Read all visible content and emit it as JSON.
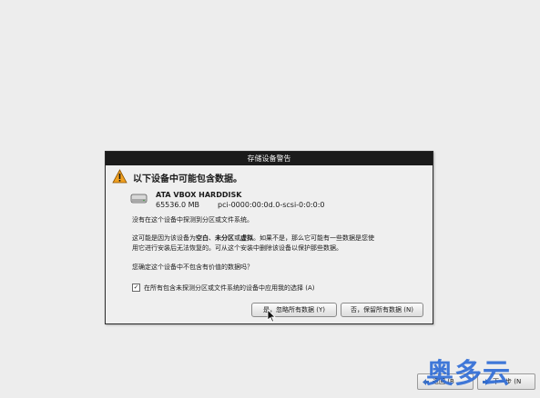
{
  "dialog": {
    "title": "存储设备警告",
    "heading": "以下设备中可能包含数据。",
    "disk": {
      "name": "ATA VBOX HARDDISK",
      "size": "65536.0 MB",
      "path": "pci-0000:00:0d.0-scsi-0:0:0:0"
    },
    "line1": "没有在这个设备中探测到分区或文件系统。",
    "line2_pre": "这可能是因为该设备为",
    "line2_blank": "空白",
    "line2_sep": "、",
    "line2_unpart": "未分区",
    "line2_or": "或",
    "line2_virtual": "虚拟",
    "line2_post": "。如果不是，那么它可能有一些数据是您使",
    "line3": "用它进行安装后无法恢复的。可从这个安装中删除该设备以保护那些数据。",
    "question": "您确定这个设备中不包含有价值的数据吗？",
    "checkbox_label": "在所有包含未探测分区或文件系统的设备中应用我的选择 (A)",
    "checkbox_checked": true,
    "yes_button": "是，忽略所有数据 (Y)",
    "no_button": "否，保留所有数据 (N)"
  },
  "nav": {
    "back": "返回 (B",
    "next": "下一步 (N"
  },
  "watermark": "奥多云",
  "colors": {
    "warning": "#f0a020",
    "accent": "#2d6bd6"
  }
}
